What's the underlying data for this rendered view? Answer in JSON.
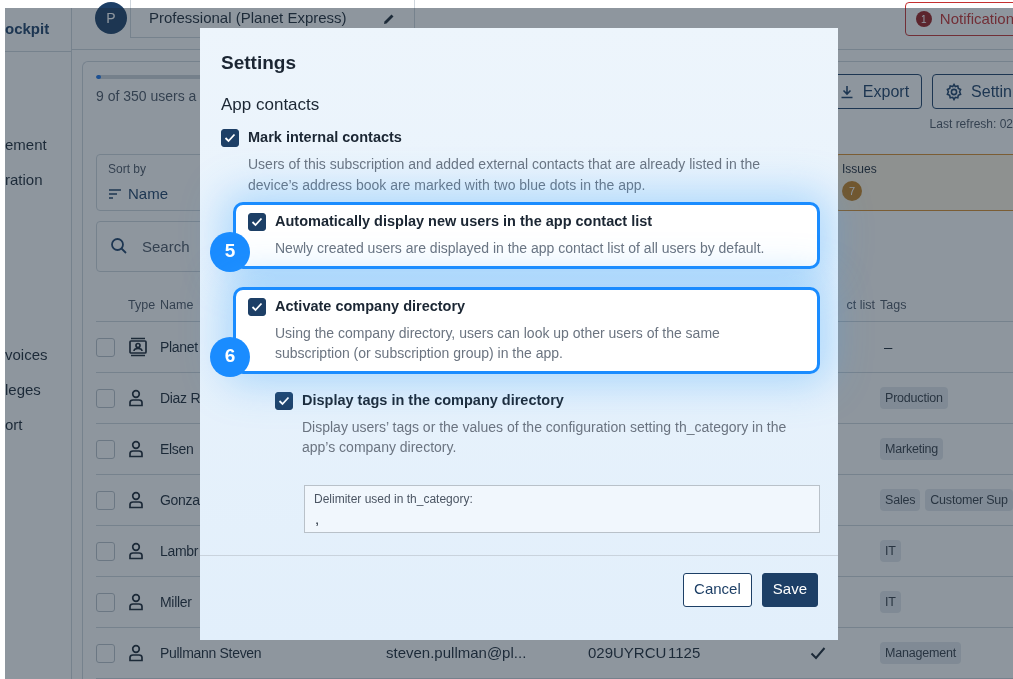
{
  "sidebar": {
    "title": "ockpit",
    "sections": [
      {
        "items": [
          "ement",
          "ration"
        ]
      },
      {
        "items": [
          "voices",
          "leges",
          "ort"
        ]
      }
    ]
  },
  "header": {
    "avatar": "P",
    "tab": "Professional (Planet Express)",
    "notification": {
      "count": "1",
      "label": "Notification"
    }
  },
  "users_panel": {
    "progress": {
      "level": 0.026
    },
    "summary": "9 of 350 users a",
    "actions": [
      {
        "label": "Export",
        "kind": "export"
      },
      {
        "label": "Settin",
        "kind": "settings"
      }
    ],
    "last_refresh": "Last refresh: 02",
    "sort": {
      "label": "Sort by",
      "value": "Name"
    },
    "issues": {
      "label": "Issues",
      "count": "7"
    },
    "search": {
      "placeholder": "Search"
    },
    "table": {
      "columns": {
        "type": "Type",
        "name": "Name",
        "contact_list": "ct list",
        "tags": "Tags"
      },
      "rows": [
        {
          "kind": "group",
          "checked": false,
          "name": "Planet",
          "empty_tags": "–"
        },
        {
          "kind": "user",
          "checked": false,
          "name": "Diaz R",
          "tags": [
            "Production"
          ]
        },
        {
          "kind": "user",
          "checked": false,
          "name": "Elsen",
          "tags": [
            "Marketing"
          ]
        },
        {
          "kind": "user",
          "checked": false,
          "name": "Gonza",
          "tags": [
            "Sales",
            "Customer Sup"
          ]
        },
        {
          "kind": "user",
          "checked": false,
          "name": "Lambr",
          "tags": [
            "IT"
          ]
        },
        {
          "kind": "user",
          "checked": false,
          "name": "Miller",
          "tags": [
            "IT"
          ]
        },
        {
          "kind": "user",
          "checked": false,
          "name": "Pullmann Steven",
          "email": "steven.pullman@pl...",
          "id": "029UYRCU",
          "number": "1125",
          "in_contact_list": true,
          "tags": [
            "Management"
          ]
        }
      ]
    }
  },
  "settings_dialog": {
    "title": "Settings",
    "section": "App contacts",
    "options": [
      {
        "label": "Mark internal contacts",
        "description": "Users of this subscription and added external contacts that are already listed in the device’s address book are marked with two blue dots in the app.",
        "checked": true,
        "highlighted": false
      },
      {
        "label": "Automatically display new users in the app contact list",
        "description": "Newly created users are displayed in the app contact list of all users by default.",
        "checked": true,
        "highlighted": true,
        "step": "5"
      },
      {
        "label": "Activate company directory",
        "description": "Using the company directory, users can look up other users of the same subscription (or subscription group) in the app.",
        "checked": true,
        "highlighted": true,
        "step": "6",
        "children": [
          {
            "label": "Display tags in the company directory",
            "description": "Display users’ tags or the values of the configuration setting th_category in the app’s company directory.",
            "checked": true,
            "highlighted": false
          }
        ]
      }
    ],
    "delimiter_field": {
      "label": "Delimiter used in th_category:",
      "value": ","
    },
    "buttons": [
      {
        "label": "Cancel",
        "kind": "secondary"
      },
      {
        "label": "Save",
        "kind": "primary"
      }
    ]
  }
}
